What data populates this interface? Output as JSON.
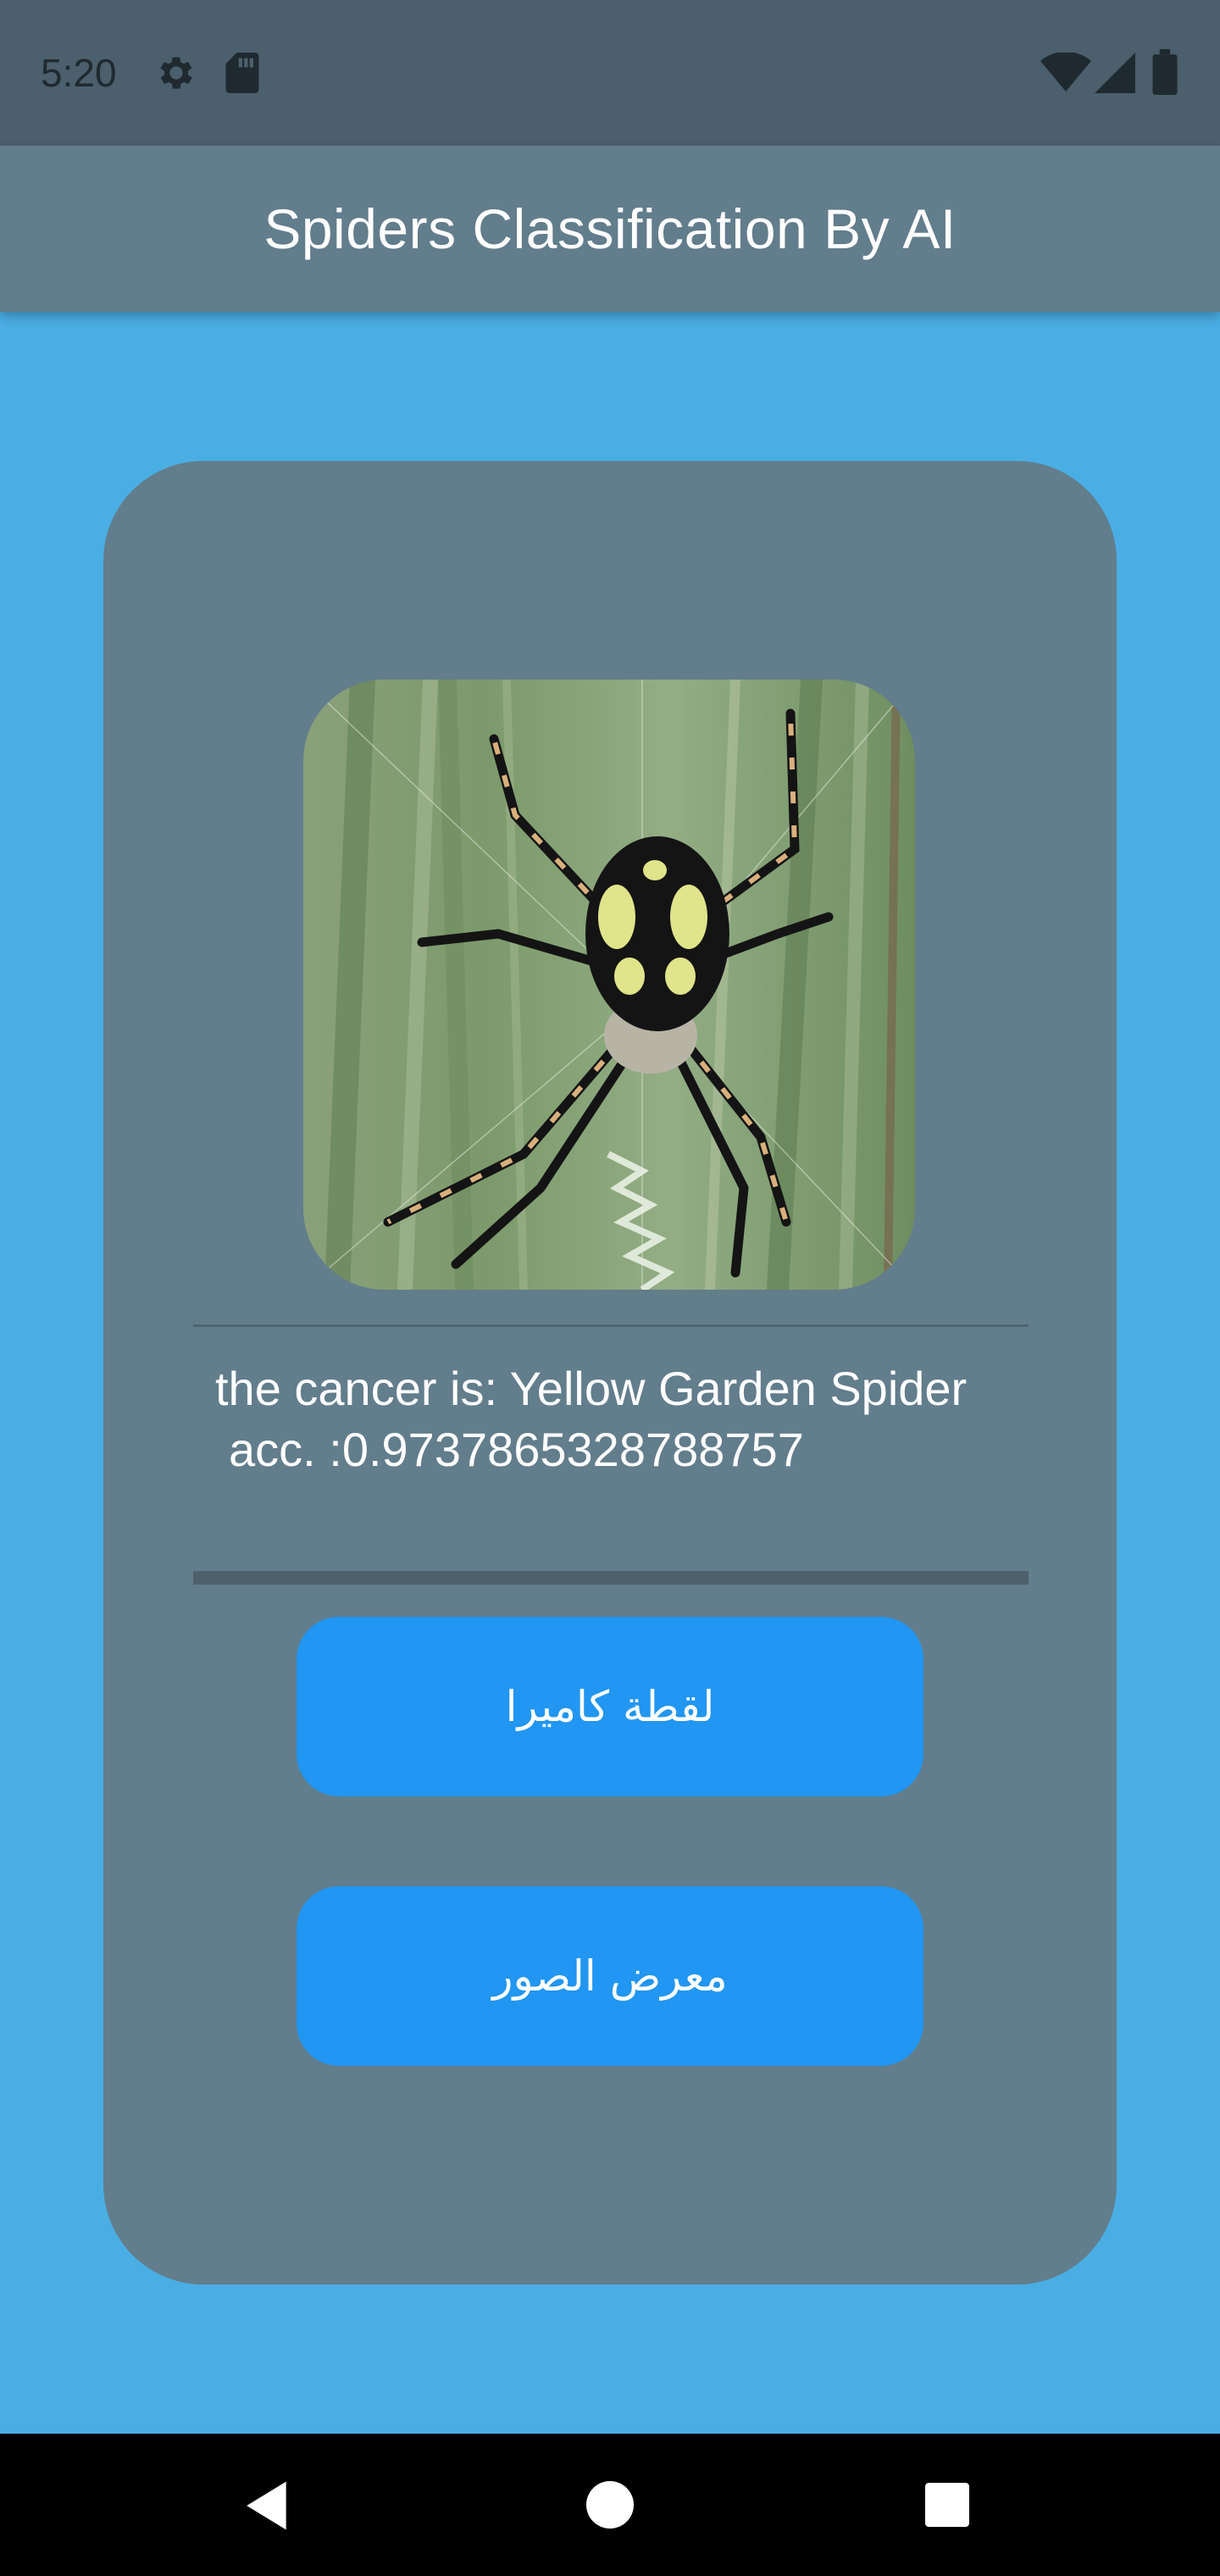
{
  "status_bar": {
    "time": "5:20",
    "icons": [
      "gear-icon",
      "sd-card-icon",
      "wifi-icon",
      "signal-icon",
      "battery-icon"
    ]
  },
  "app_bar": {
    "title": "Spiders Classification By AI"
  },
  "result": {
    "line1": "the cancer is: Yellow Garden Spider",
    "line2": "acc. :0.9737865328788757"
  },
  "buttons": {
    "camera": "لقطة كاميرا",
    "gallery": "معرض الصور"
  },
  "nav_bar": {
    "icons": [
      "back-icon",
      "home-icon",
      "recents-icon"
    ]
  },
  "colors": {
    "background": "#4aaee4",
    "app_bar": "#627d8b",
    "card": "#627d8b",
    "button": "#2196f2",
    "status_bar": "#4b606c"
  }
}
